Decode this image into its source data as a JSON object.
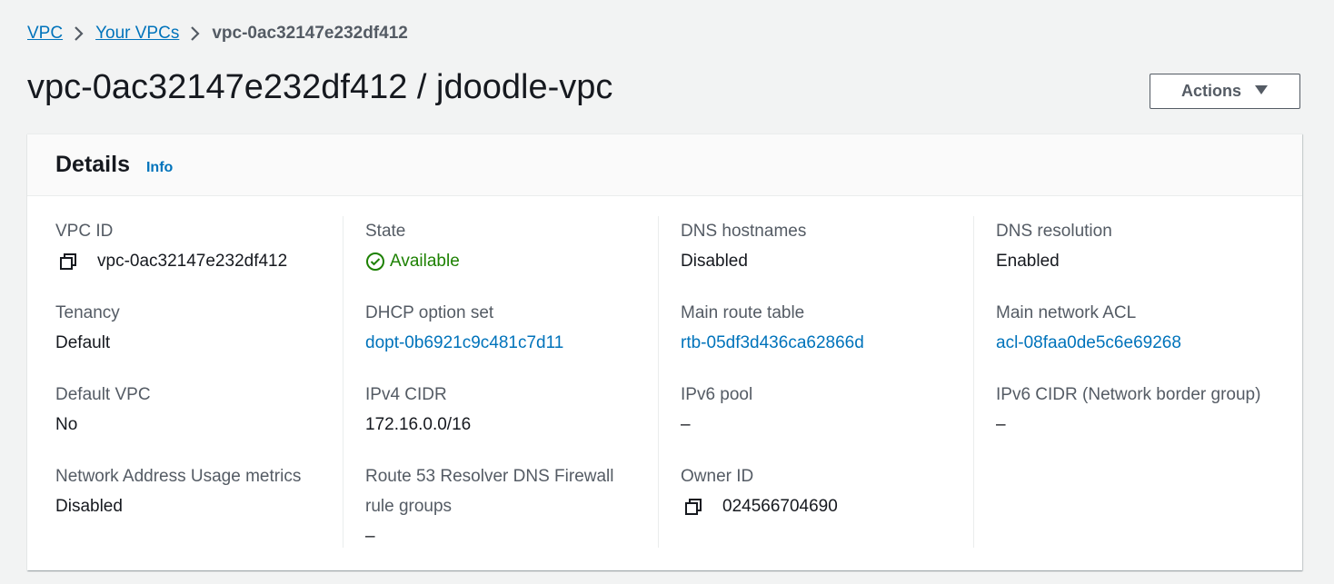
{
  "breadcrumb": {
    "vpc": "VPC",
    "your_vpcs": "Your VPCs",
    "current": "vpc-0ac32147e232df412"
  },
  "page_title": "vpc-0ac32147e232df412 / jdoodle-vpc",
  "actions": {
    "label": "Actions",
    "icon": "caret-down-icon"
  },
  "details": {
    "title": "Details",
    "info_link": "Info",
    "columns": [
      [
        {
          "label": "VPC ID",
          "value": "vpc-0ac32147e232df412",
          "icon": "copy-icon"
        },
        {
          "label": "Tenancy",
          "value": "Default"
        },
        {
          "label": "Default VPC",
          "value": "No"
        },
        {
          "label": "Network Address Usage metrics",
          "value": "Disabled"
        }
      ],
      [
        {
          "label": "State",
          "value": "Available",
          "icon": "check-circle-icon",
          "color": "#1d8102"
        },
        {
          "label": "DHCP option set",
          "value": "dopt-0b6921c9c481c7d11",
          "link": true
        },
        {
          "label": "IPv4 CIDR",
          "value": "172.16.0.0/16"
        },
        {
          "label": "Route 53 Resolver DNS Firewall rule groups",
          "value": "–"
        }
      ],
      [
        {
          "label": "DNS hostnames",
          "value": "Disabled"
        },
        {
          "label": "Main route table",
          "value": "rtb-05df3d436ca62866d",
          "link": true
        },
        {
          "label": "IPv6 pool",
          "value": "–"
        },
        {
          "label": "Owner ID",
          "value": "024566704690",
          "icon": "copy-icon"
        }
      ],
      [
        {
          "label": "DNS resolution",
          "value": "Enabled"
        },
        {
          "label": "Main network ACL",
          "value": "acl-08faa0de5c6e69268",
          "link": true
        },
        {
          "label": "IPv6 CIDR (Network border group)",
          "value": "–"
        }
      ]
    ]
  },
  "colors": {
    "link": "#0073bb",
    "success": "#1d8102",
    "text": "#16191f",
    "muted": "#545b64"
  }
}
